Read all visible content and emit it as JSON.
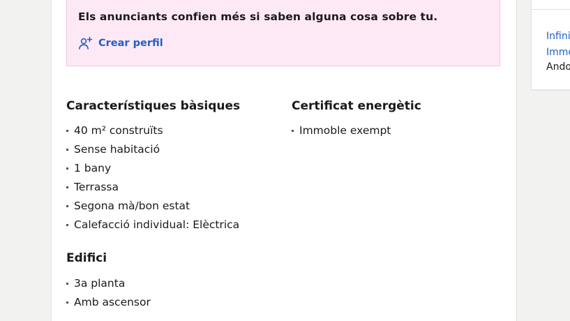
{
  "banner": {
    "message": "Els anunciants confien més si saben alguna cosa sobre tu.",
    "create_profile_label": "Crear perfil",
    "bg_color": "#fde9f6",
    "link_color": "#1f5fc9"
  },
  "basic": {
    "title": "Característiques bàsiques",
    "items": [
      "40 m² construïts",
      "Sense habitació",
      "1 bany",
      "Terrassa",
      "Segona mà/bon estat",
      "Calefacció individual: Elèctrica"
    ]
  },
  "energy": {
    "title": "Certificat energètic",
    "items": [
      "Immoble exempt"
    ]
  },
  "building": {
    "title": "Edifici",
    "items": [
      "3a planta",
      "Amb ascensor"
    ]
  },
  "sidebar": {
    "link_1": "Infini",
    "link_2": "Immo",
    "location": "Ando"
  }
}
